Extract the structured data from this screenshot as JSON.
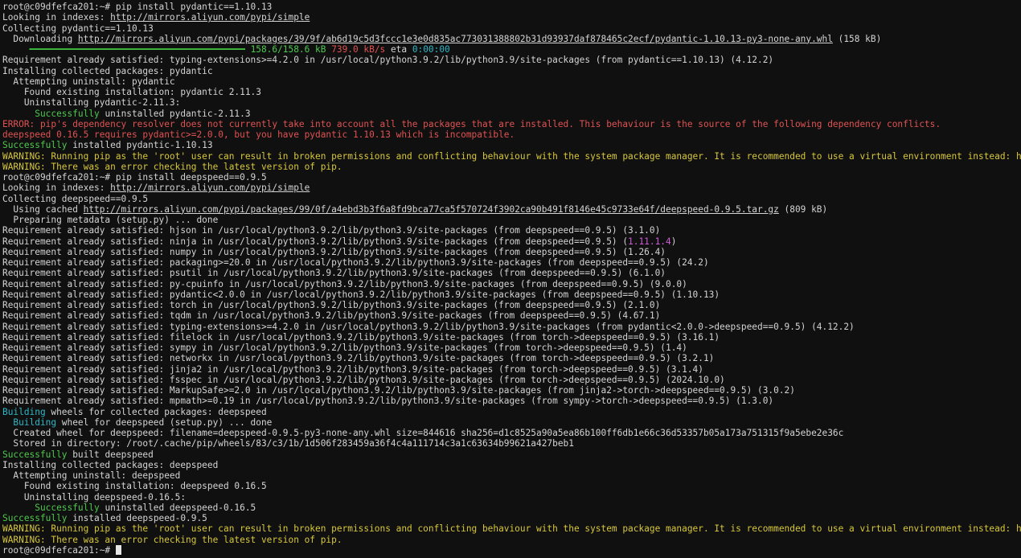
{
  "terminal": {
    "lines": [
      [
        [
          "root@c09dfefca201:~# pip install pydantic==1.10.13",
          "norm"
        ]
      ],
      [
        [
          "Looking in indexes: ",
          "norm"
        ],
        [
          "http://mirrors.aliyun.com/pypi/simple",
          "link"
        ]
      ],
      [
        [
          "Collecting pydantic==1.10.13",
          "norm"
        ]
      ],
      [
        [
          "  Downloading ",
          "norm"
        ],
        [
          "http://mirrors.aliyun.com/pypi/packages/39/9f/ab6d19c5d3fccc1e3e0d835ac773031388802b31d93937daf878465c2ecf/pydantic-1.10.13-py3-none-any.whl",
          "link"
        ],
        [
          " (158 kB)",
          "norm"
        ]
      ],
      [
        [
          "     ",
          "norm"
        ],
        [
          "━━━━━━━━━━━━━━━━━━━━━━━━━━━━━━━━━━━━━━━━",
          "bar"
        ],
        [
          " ",
          "norm"
        ],
        [
          "158.6/158.6 kB",
          "green"
        ],
        [
          " ",
          "norm"
        ],
        [
          "739.0 kB/s",
          "red"
        ],
        [
          " eta ",
          "norm"
        ],
        [
          "0:00:00",
          "cyan"
        ]
      ],
      [
        [
          "Requirement already satisfied: typing-extensions>=4.2.0 in /usr/local/python3.9.2/lib/python3.9/site-packages (from pydantic==1.10.13) (4.12.2)",
          "norm"
        ]
      ],
      [
        [
          "Installing collected packages: pydantic",
          "norm"
        ]
      ],
      [
        [
          "  Attempting uninstall: pydantic",
          "norm"
        ]
      ],
      [
        [
          "    Found existing installation: pydantic 2.11.3",
          "norm"
        ]
      ],
      [
        [
          "    Uninstalling pydantic-2.11.3:",
          "norm"
        ]
      ],
      [
        [
          "      Successfully",
          "green"
        ],
        [
          " uninstalled pydantic-2.11.3",
          "norm"
        ]
      ],
      [
        [
          "ERROR: pip's dependency resolver does not currently take into account all the packages that are installed. This behaviour is the source of the following dependency conflicts.",
          "red"
        ]
      ],
      [
        [
          "deepspeed 0.16.5 requires pydantic>=2.0.0, but you have pydantic 1.10.13 which is incompatible.",
          "red"
        ]
      ],
      [
        [
          "Successfully",
          "green"
        ],
        [
          " installed pydantic-1.10.13",
          "norm"
        ]
      ],
      [
        [
          "WARNING: Running pip as the 'root' user can result in broken permissions and conflicting behaviour with the system package manager. It is recommended to use a virtual environment instead: http",
          "yellow"
        ]
      ],
      [
        [
          "WARNING: There was an error checking the latest version of pip.",
          "yellow"
        ]
      ],
      [
        [
          "root@c09dfefca201:~# pip install deepspeed==0.9.5",
          "norm"
        ]
      ],
      [
        [
          "Looking in indexes: ",
          "norm"
        ],
        [
          "http://mirrors.aliyun.com/pypi/simple",
          "link"
        ]
      ],
      [
        [
          "Collecting deepspeed==0.9.5",
          "norm"
        ]
      ],
      [
        [
          "  Using cached ",
          "norm"
        ],
        [
          "http://mirrors.aliyun.com/pypi/packages/99/0f/a4ebd3b3f6a8fd9bca77ca5f570724f3902ca90b491f8146e45c9733e64f/deepspeed-0.9.5.tar.gz",
          "link"
        ],
        [
          " (809 kB)",
          "norm"
        ]
      ],
      [
        [
          "  Preparing metadata (setup.py) ... done",
          "norm"
        ]
      ],
      [
        [
          "Requirement already satisfied: hjson in /usr/local/python3.9.2/lib/python3.9/site-packages (from deepspeed==0.9.5) (3.1.0)",
          "norm"
        ]
      ],
      [
        [
          "Requirement already satisfied: ninja in /usr/local/python3.9.2/lib/python3.9/site-packages (from deepspeed==0.9.5) (",
          "norm"
        ],
        [
          "1.11.1.4",
          "magenta"
        ],
        [
          ")",
          "norm"
        ]
      ],
      [
        [
          "Requirement already satisfied: numpy in /usr/local/python3.9.2/lib/python3.9/site-packages (from deepspeed==0.9.5) (1.26.4)",
          "norm"
        ]
      ],
      [
        [
          "Requirement already satisfied: packaging>=20.0 in /usr/local/python3.9.2/lib/python3.9/site-packages (from deepspeed==0.9.5) (24.2)",
          "norm"
        ]
      ],
      [
        [
          "Requirement already satisfied: psutil in /usr/local/python3.9.2/lib/python3.9/site-packages (from deepspeed==0.9.5) (6.1.0)",
          "norm"
        ]
      ],
      [
        [
          "Requirement already satisfied: py-cpuinfo in /usr/local/python3.9.2/lib/python3.9/site-packages (from deepspeed==0.9.5) (9.0.0)",
          "norm"
        ]
      ],
      [
        [
          "Requirement already satisfied: pydantic<2.0.0 in /usr/local/python3.9.2/lib/python3.9/site-packages (from deepspeed==0.9.5) (1.10.13)",
          "norm"
        ]
      ],
      [
        [
          "Requirement already satisfied: torch in /usr/local/python3.9.2/lib/python3.9/site-packages (from deepspeed==0.9.5) (2.1.0)",
          "norm"
        ]
      ],
      [
        [
          "Requirement already satisfied: tqdm in /usr/local/python3.9.2/lib/python3.9/site-packages (from deepspeed==0.9.5) (4.67.1)",
          "norm"
        ]
      ],
      [
        [
          "Requirement already satisfied: typing-extensions>=4.2.0 in /usr/local/python3.9.2/lib/python3.9/site-packages (from pydantic<2.0.0->deepspeed==0.9.5) (4.12.2)",
          "norm"
        ]
      ],
      [
        [
          "Requirement already satisfied: filelock in /usr/local/python3.9.2/lib/python3.9/site-packages (from torch->deepspeed==0.9.5) (3.16.1)",
          "norm"
        ]
      ],
      [
        [
          "Requirement already satisfied: sympy in /usr/local/python3.9.2/lib/python3.9/site-packages (from torch->deepspeed==0.9.5) (1.4)",
          "norm"
        ]
      ],
      [
        [
          "Requirement already satisfied: networkx in /usr/local/python3.9.2/lib/python3.9/site-packages (from torch->deepspeed==0.9.5) (3.2.1)",
          "norm"
        ]
      ],
      [
        [
          "Requirement already satisfied: jinja2 in /usr/local/python3.9.2/lib/python3.9/site-packages (from torch->deepspeed==0.9.5) (3.1.4)",
          "norm"
        ]
      ],
      [
        [
          "Requirement already satisfied: fsspec in /usr/local/python3.9.2/lib/python3.9/site-packages (from torch->deepspeed==0.9.5) (2024.10.0)",
          "norm"
        ]
      ],
      [
        [
          "Requirement already satisfied: MarkupSafe>=2.0 in /usr/local/python3.9.2/lib/python3.9/site-packages (from jinja2->torch->deepspeed==0.9.5) (3.0.2)",
          "norm"
        ]
      ],
      [
        [
          "Requirement already satisfied: mpmath>=0.19 in /usr/local/python3.9.2/lib/python3.9/site-packages (from sympy->torch->deepspeed==0.9.5) (1.3.0)",
          "norm"
        ]
      ],
      [
        [
          "Building",
          "cyan"
        ],
        [
          " wheels for collected packages: deepspeed",
          "norm"
        ]
      ],
      [
        [
          "  Building",
          "cyan"
        ],
        [
          " wheel for deepspeed (setup.py) ... done",
          "norm"
        ]
      ],
      [
        [
          "  Created wheel for deepspeed: filename=deepspeed-0.9.5-py3-none-any.whl size=844616 sha256=d1c8525a90a5ea86b100ff6db1e66c36d53357b05a173a751315f9a5ebe2e36c",
          "norm"
        ]
      ],
      [
        [
          "  Stored in directory: /root/.cache/pip/wheels/83/c3/1b/1d506f283459a36f4c4a111714c3a1c63634b99621a427beb1",
          "norm"
        ]
      ],
      [
        [
          "Successfully",
          "green"
        ],
        [
          " built deepspeed",
          "norm"
        ]
      ],
      [
        [
          "Installing collected packages: deepspeed",
          "norm"
        ]
      ],
      [
        [
          "  Attempting uninstall: deepspeed",
          "norm"
        ]
      ],
      [
        [
          "    Found existing installation: deepspeed 0.16.5",
          "norm"
        ]
      ],
      [
        [
          "    Uninstalling deepspeed-0.16.5:",
          "norm"
        ]
      ],
      [
        [
          "      Successfully",
          "green"
        ],
        [
          " uninstalled deepspeed-0.16.5",
          "norm"
        ]
      ],
      [
        [
          "Successfully",
          "green"
        ],
        [
          " installed deepspeed-0.9.5",
          "norm"
        ]
      ],
      [
        [
          "WARNING: Running pip as the 'root' user can result in broken permissions and conflicting behaviour with the system package manager. It is recommended to use a virtual environment instead: http",
          "yellow"
        ]
      ],
      [
        [
          "WARNING: There was an error checking the latest version of pip.",
          "yellow"
        ]
      ],
      [
        [
          "root@c09dfefca201:~# ",
          "norm"
        ]
      ]
    ],
    "cursor": true
  }
}
